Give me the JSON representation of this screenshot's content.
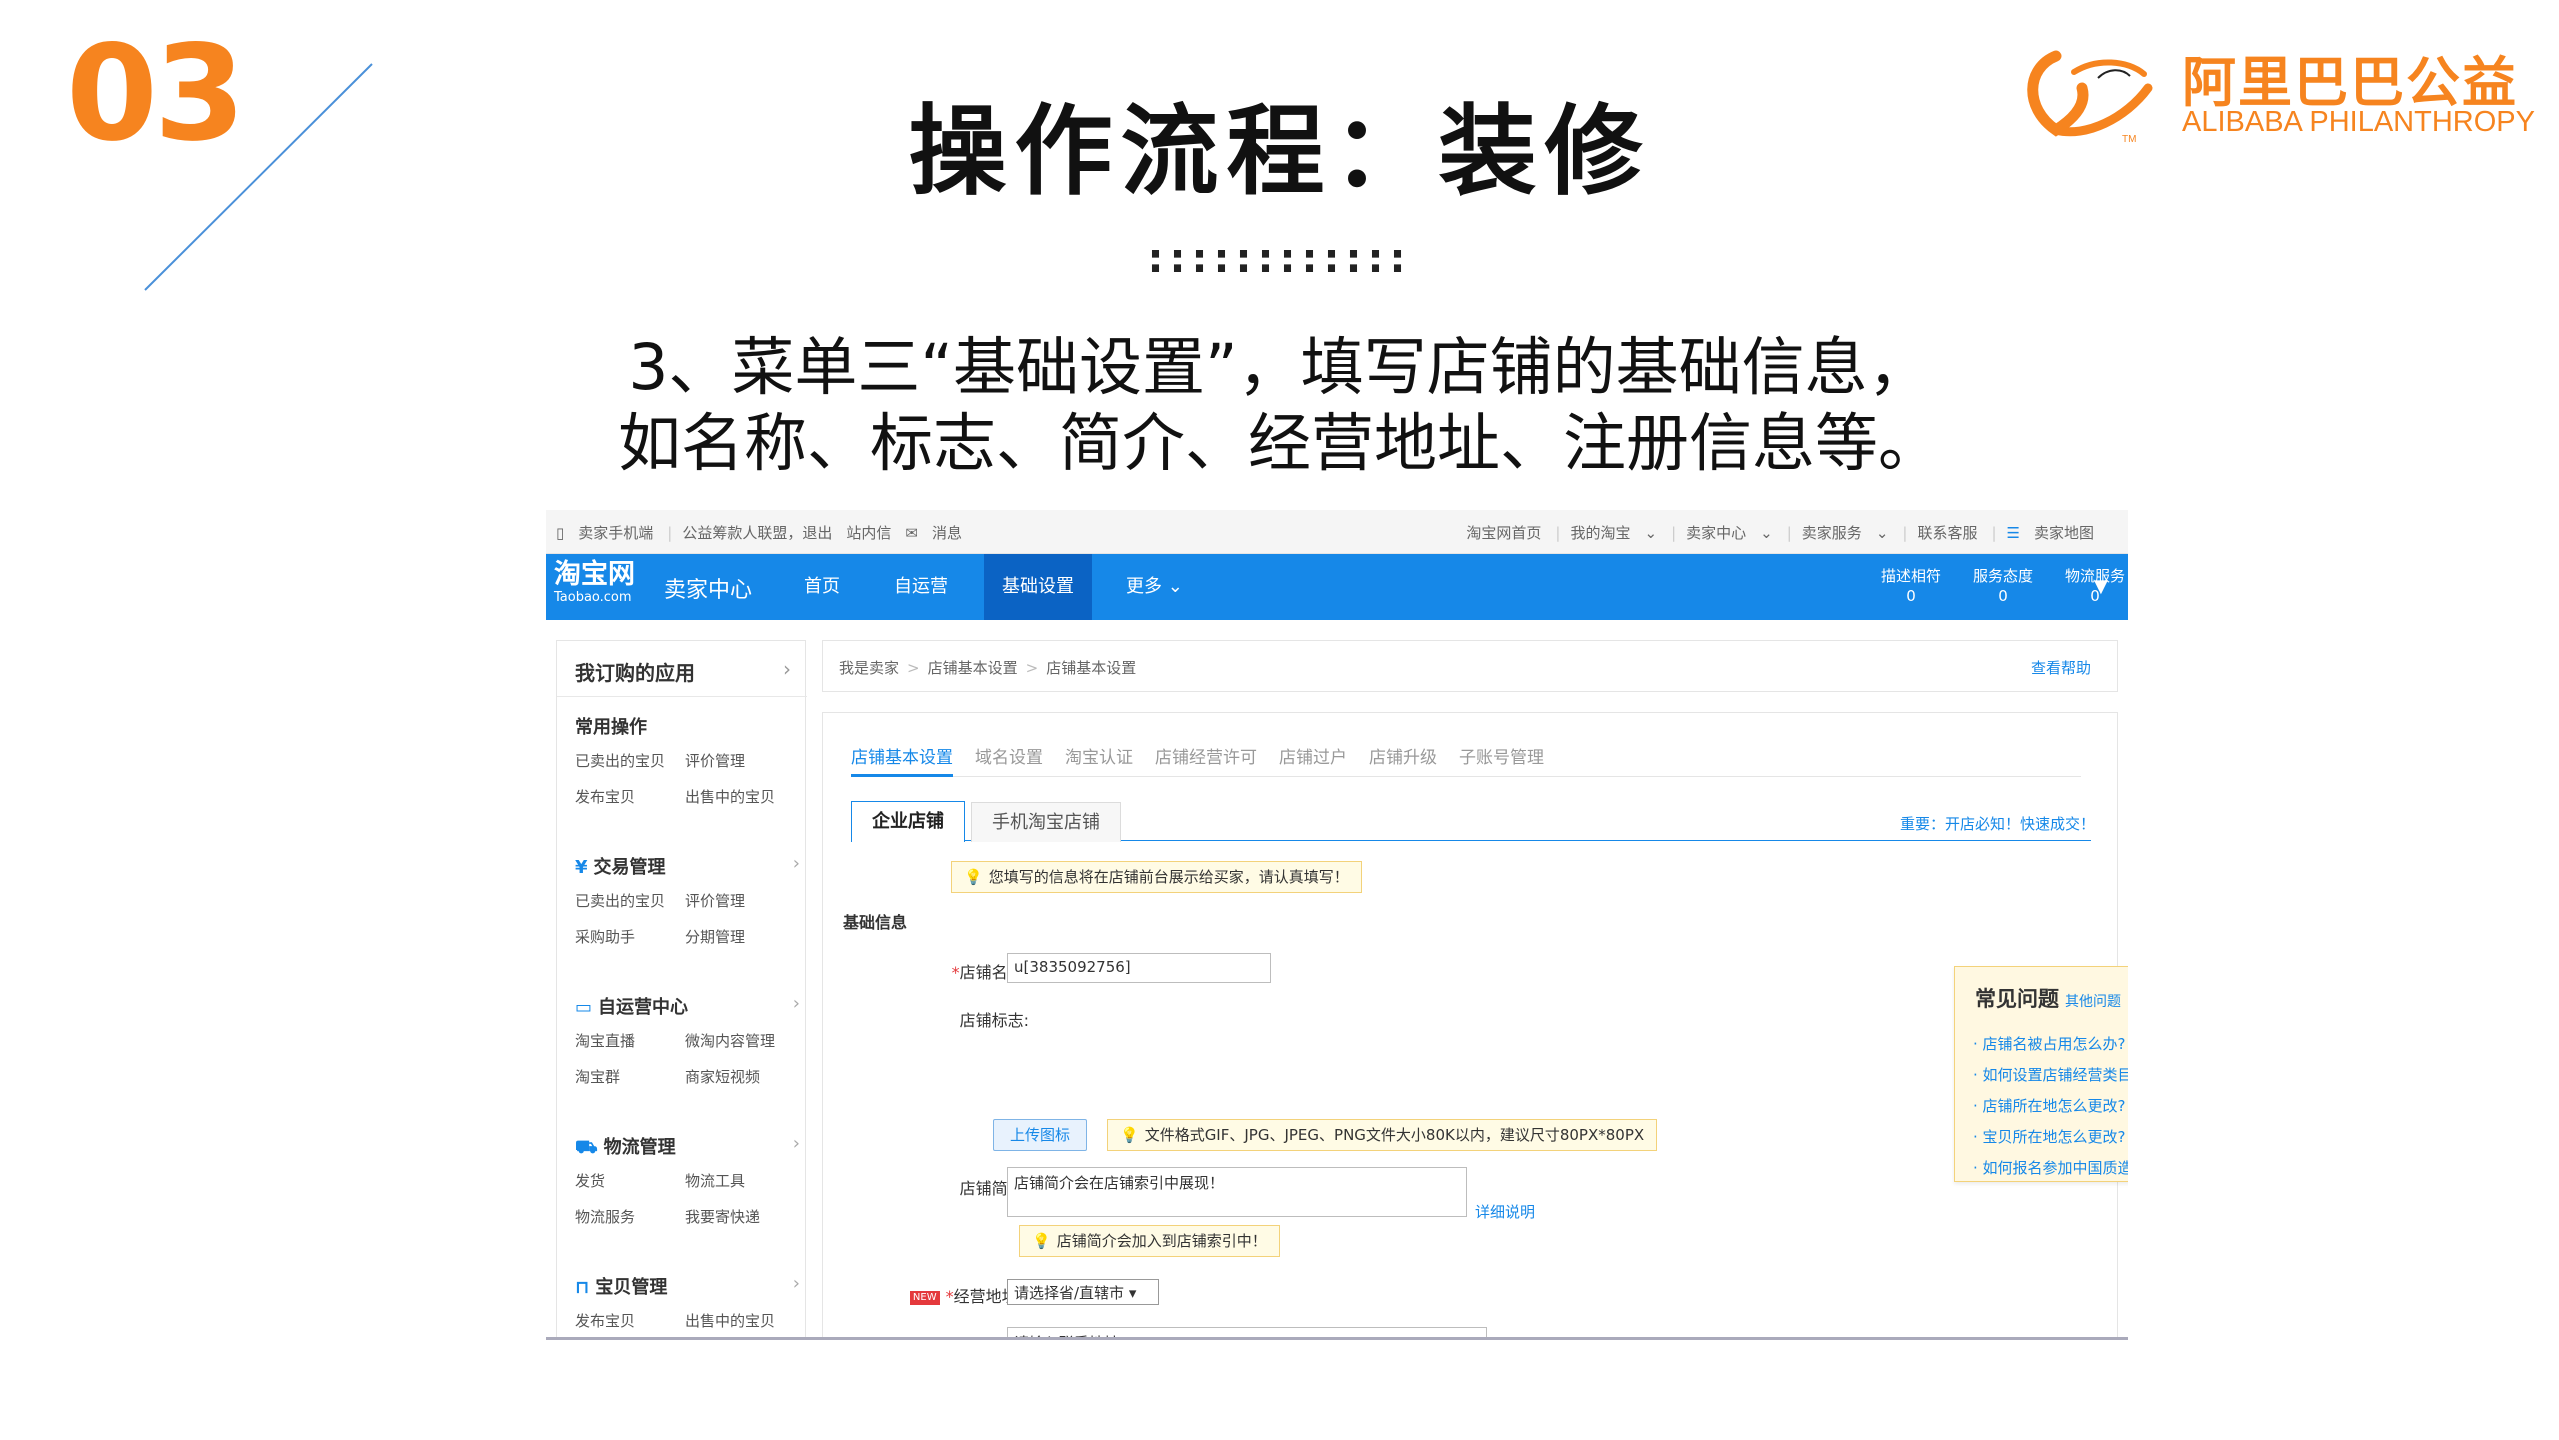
{
  "slide": {
    "number": "03",
    "title": "操作流程：装修",
    "dots": "::::::::::::",
    "description": [
      "3、菜单三“基础设置”，填写店铺的基础信息，",
      "如名称、标志、简介、经营地址、注册信息等。"
    ]
  },
  "logo": {
    "cn": "阿里巴巴公益",
    "en": "ALIBABA PHILANTHROPY",
    "tm": "TM"
  },
  "colors": {
    "accent": "#f6841f",
    "taobao_blue": "#1688e8"
  },
  "topbar": {
    "left": [
      "卖家手机端",
      "公益筹款人联盟，退出",
      "站内信",
      "消息"
    ],
    "right": [
      "淘宝网首页",
      "我的淘宝",
      "卖家中心",
      "卖家服务",
      "联系客服",
      "卖家地图"
    ]
  },
  "navbar": {
    "logo": "淘宝网",
    "logo_sub": "Taobao.com",
    "subtitle": "卖家中心",
    "items": [
      "首页",
      "自运营",
      "基础设置",
      "更多"
    ],
    "active": "基础设置",
    "metrics": [
      {
        "label": "描述相符",
        "value": "0"
      },
      {
        "label": "服务态度",
        "value": "0"
      },
      {
        "label": "物流服务",
        "value": "0"
      }
    ]
  },
  "sidebar": {
    "app": "我订购的应用",
    "sections": [
      {
        "title": "常用操作",
        "icon": "none",
        "links": [
          [
            "已卖出的宝贝",
            "评价管理"
          ],
          [
            "发布宝贝",
            "出售中的宝贝"
          ]
        ]
      },
      {
        "title": "交易管理",
        "icon": "yen-icon",
        "links": [
          [
            "已卖出的宝贝",
            "评价管理"
          ],
          [
            "采购助手",
            "分期管理"
          ]
        ]
      },
      {
        "title": "自运营中心",
        "icon": "chat-icon",
        "links": [
          [
            "淘宝直播",
            "微淘内容管理"
          ],
          [
            "淘宝群",
            "商家短视频"
          ]
        ]
      },
      {
        "title": "物流管理",
        "icon": "truck-icon",
        "links": [
          [
            "发货",
            "物流工具"
          ],
          [
            "物流服务",
            "我要寄快递"
          ]
        ]
      },
      {
        "title": "宝贝管理",
        "icon": "bag-icon",
        "links": [
          [
            "发布宝贝",
            "出售中的宝贝"
          ]
        ]
      }
    ]
  },
  "breadcrumb": {
    "items": [
      "我是卖家",
      "店铺基本设置",
      "店铺基本设置"
    ],
    "help": "查看帮助"
  },
  "tabs": {
    "items": [
      "店铺基本设置",
      "域名设置",
      "淘宝认证",
      "店铺经营许可",
      "店铺过户",
      "店铺升级",
      "子账号管理"
    ],
    "active": "店铺基本设置"
  },
  "subtabs": {
    "items": [
      "企业店铺",
      "手机淘宝店铺"
    ],
    "active": "企业店铺"
  },
  "notice": "重要：开店必知！快速成交！",
  "form": {
    "top_tip": "您填写的信息将在店铺前台展示给买家，请认真填写！",
    "section": "基础信息",
    "name_label": "店铺名称:",
    "name_value": "u[3835092756]",
    "logo_label": "店铺标志:",
    "upload_button": "上传图标",
    "upload_tip": "文件格式GIF、JPG、JPEG、PNG文件大小80K以内，建议尺寸80PX*80PX",
    "intro_label": "店铺简介:",
    "intro_value": "店铺简介会在店铺索引中展现！",
    "intro_link": "详细说明",
    "intro_tip": "店铺简介会加入到店铺索引中！",
    "address_label": "经营地址:",
    "new_badge": "NEW",
    "province_select": "请选择省/直辖市",
    "address_placeholder": "请输入联系地址"
  },
  "faq": {
    "title": "常见问题",
    "more": "其他问题",
    "close": "×",
    "items": [
      "店铺名被占用怎么办?",
      "如何设置店铺经营类目?",
      "店铺所在地怎么更改?",
      "宝贝所在地怎么更改?",
      "如何报名参加中国质造"
    ]
  }
}
